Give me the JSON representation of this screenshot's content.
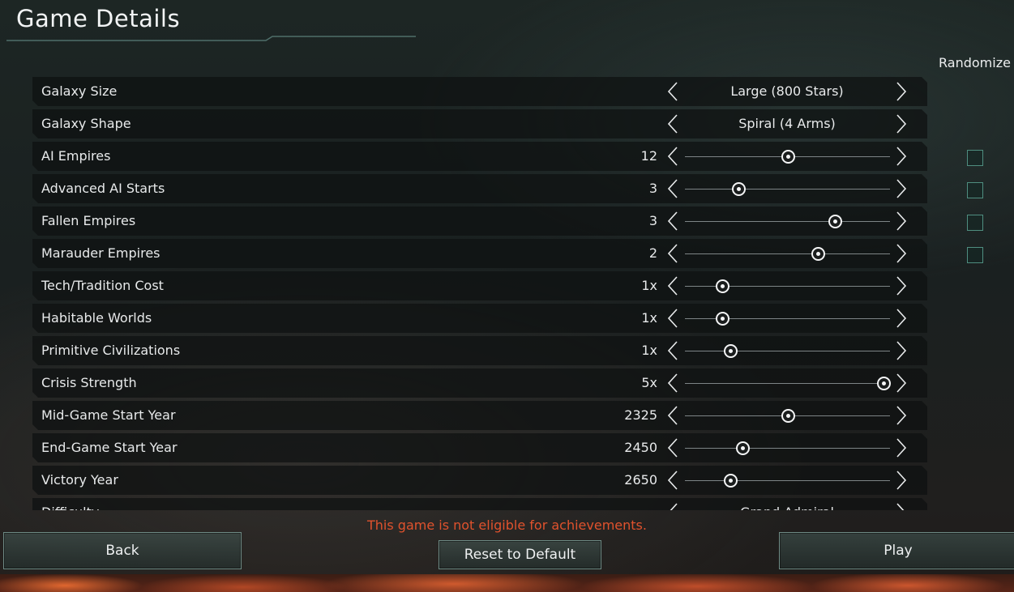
{
  "header": {
    "title": "Game Details"
  },
  "randomize_label": "Randomize",
  "rows": [
    {
      "label": "Galaxy Size",
      "kind": "choice",
      "value": "Large (800 Stars)"
    },
    {
      "label": "Galaxy Shape",
      "kind": "choice",
      "value": "Spiral (4 Arms)"
    },
    {
      "label": "AI Empires",
      "kind": "slider",
      "value": "12",
      "level": 0.5,
      "randomize": false
    },
    {
      "label": "Advanced AI Starts",
      "kind": "slider",
      "value": "3",
      "level": 0.26,
      "randomize": false
    },
    {
      "label": "Fallen Empires",
      "kind": "slider",
      "value": "3",
      "level": 0.73,
      "randomize": false
    },
    {
      "label": "Marauder Empires",
      "kind": "slider",
      "value": "2",
      "level": 0.65,
      "randomize": false
    },
    {
      "label": "Tech/Tradition Cost",
      "kind": "slider",
      "value": "1x",
      "level": 0.18
    },
    {
      "label": "Habitable Worlds",
      "kind": "slider",
      "value": "1x",
      "level": 0.18
    },
    {
      "label": "Primitive Civilizations",
      "kind": "slider",
      "value": "1x",
      "level": 0.22
    },
    {
      "label": "Crisis Strength",
      "kind": "slider",
      "value": "5x",
      "level": 0.97
    },
    {
      "label": "Mid-Game Start Year",
      "kind": "slider",
      "value": "2325",
      "level": 0.5
    },
    {
      "label": "End-Game Start Year",
      "kind": "slider",
      "value": "2450",
      "level": 0.28
    },
    {
      "label": "Victory Year",
      "kind": "slider",
      "value": "2650",
      "level": 0.22
    },
    {
      "label": "Difficulty",
      "kind": "choice",
      "value": "Grand Admiral"
    }
  ],
  "warning": "This game is not eligible for achievements.",
  "buttons": {
    "back": "Back",
    "reset": "Reset to Default",
    "play": "Play"
  },
  "colors": {
    "warning": "#e0522d",
    "accent": "#4f8e80"
  }
}
